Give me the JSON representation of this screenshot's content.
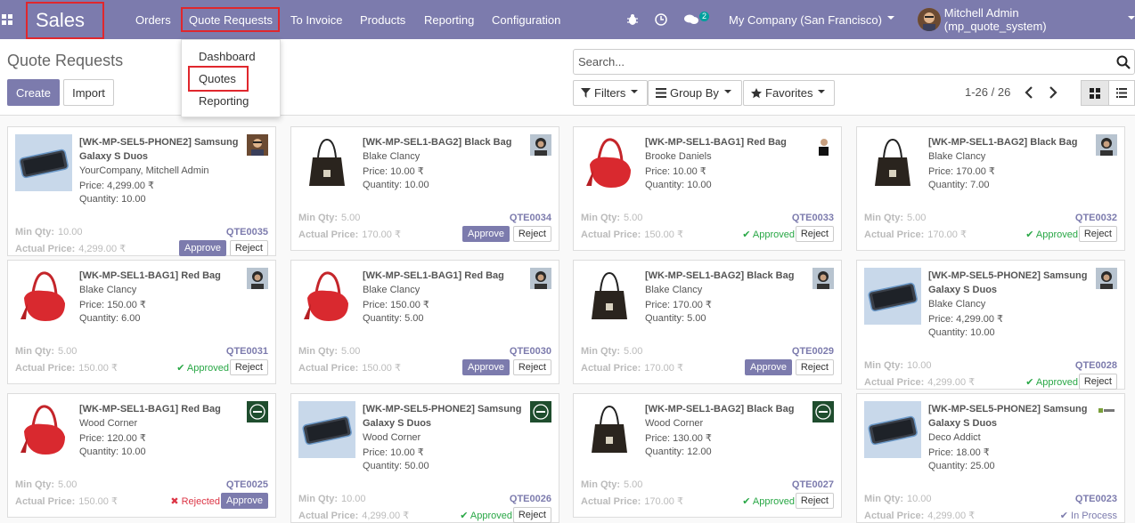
{
  "app": {
    "brand": "Sales"
  },
  "menu": {
    "orders": "Orders",
    "quote_requests": "Quote Requests",
    "to_invoice": "To Invoice",
    "products": "Products",
    "reporting": "Reporting",
    "configuration": "Configuration"
  },
  "systray": {
    "chat_count": "2",
    "company": "My Company (San Francisco)",
    "user": "Mitchell Admin (mp_quote_system)"
  },
  "dropdown": {
    "dashboard": "Dashboard",
    "quotes": "Quotes",
    "reporting": "Reporting"
  },
  "page": {
    "title": "Quote Requests",
    "create": "Create",
    "import": "Import"
  },
  "search": {
    "placeholder": "Search..."
  },
  "filters": {
    "filters": "Filters",
    "group_by": "Group By",
    "favorites": "Favorites"
  },
  "pager": {
    "range": "1-26 / 26"
  },
  "labels": {
    "min_qty": "Min Qty:",
    "actual_price": "Actual Price:",
    "approve": "Approve",
    "reject": "Reject",
    "approved": "Approved",
    "rejected": "Rejected",
    "in_process": "In Process"
  },
  "colors": {
    "primary": "#7c7bad",
    "approved": "#28a745",
    "rejected": "#dc3545",
    "highlight": "#e0272d"
  },
  "cards": [
    {
      "title": "[WK-MP-SEL5-PHONE2] Samsung Galaxy S Duos",
      "customer": "YourCompany, Mitchell Admin",
      "price": "Price: 4,299.00 ₹",
      "quantity": "Quantity: 10.00",
      "min_qty": "10.00",
      "actual_price": "4,299.00 ₹",
      "code": "QTE0035",
      "state": "pending",
      "image": "phone",
      "avatar": "admin"
    },
    {
      "title": "[WK-MP-SEL1-BAG2] Black Bag",
      "customer": "Blake Clancy",
      "price": "Price: 10.00 ₹",
      "quantity": "Quantity: 10.00",
      "min_qty": "5.00",
      "actual_price": "170.00 ₹",
      "code": "QTE0034",
      "state": "pending",
      "image": "black-bag",
      "avatar": "blake"
    },
    {
      "title": "[WK-MP-SEL1-BAG1] Red Bag",
      "customer": "Brooke Daniels",
      "price": "Price: 10.00 ₹",
      "quantity": "Quantity: 10.00",
      "min_qty": "5.00",
      "actual_price": "150.00 ₹",
      "code": "QTE0033",
      "state": "approved",
      "image": "red-bag",
      "avatar": "brooke"
    },
    {
      "title": "[WK-MP-SEL1-BAG2] Black Bag",
      "customer": "Blake Clancy",
      "price": "Price: 170.00 ₹",
      "quantity": "Quantity: 7.00",
      "min_qty": "5.00",
      "actual_price": "170.00 ₹",
      "code": "QTE0032",
      "state": "approved",
      "image": "black-bag",
      "avatar": "blake"
    },
    {
      "title": "[WK-MP-SEL1-BAG1] Red Bag",
      "customer": "Blake Clancy",
      "price": "Price: 150.00 ₹",
      "quantity": "Quantity: 6.00",
      "min_qty": "5.00",
      "actual_price": "150.00 ₹",
      "code": "QTE0031",
      "state": "approved",
      "image": "red-bag",
      "avatar": "blake"
    },
    {
      "title": "[WK-MP-SEL1-BAG1] Red Bag",
      "customer": "Blake Clancy",
      "price": "Price: 150.00 ₹",
      "quantity": "Quantity: 5.00",
      "min_qty": "5.00",
      "actual_price": "150.00 ₹",
      "code": "QTE0030",
      "state": "pending",
      "image": "red-bag",
      "avatar": "blake"
    },
    {
      "title": "[WK-MP-SEL1-BAG2] Black Bag",
      "customer": "Blake Clancy",
      "price": "Price: 170.00 ₹",
      "quantity": "Quantity: 5.00",
      "min_qty": "5.00",
      "actual_price": "170.00 ₹",
      "code": "QTE0029",
      "state": "pending",
      "image": "black-bag",
      "avatar": "blake"
    },
    {
      "title": "[WK-MP-SEL5-PHONE2] Samsung Galaxy S Duos",
      "customer": "Blake Clancy",
      "price": "Price: 4,299.00 ₹",
      "quantity": "Quantity: 10.00",
      "min_qty": "10.00",
      "actual_price": "4,299.00 ₹",
      "code": "QTE0028",
      "state": "approved",
      "image": "phone",
      "avatar": "blake"
    },
    {
      "title": "[WK-MP-SEL1-BAG1] Red Bag",
      "customer": "Wood Corner",
      "price": "Price: 120.00 ₹",
      "quantity": "Quantity: 10.00",
      "min_qty": "5.00",
      "actual_price": "150.00 ₹",
      "code": "QTE0025",
      "state": "rejected",
      "image": "red-bag",
      "avatar": "wood"
    },
    {
      "title": "[WK-MP-SEL5-PHONE2] Samsung Galaxy S Duos",
      "customer": "Wood Corner",
      "price": "Price: 10.00 ₹",
      "quantity": "Quantity: 50.00",
      "min_qty": "10.00",
      "actual_price": "4,299.00 ₹",
      "code": "QTE0026",
      "state": "approved",
      "image": "phone",
      "avatar": "wood"
    },
    {
      "title": "[WK-MP-SEL1-BAG2] Black Bag",
      "customer": "Wood Corner",
      "price": "Price: 130.00 ₹",
      "quantity": "Quantity: 12.00",
      "min_qty": "5.00",
      "actual_price": "170.00 ₹",
      "code": "QTE0027",
      "state": "approved",
      "image": "black-bag",
      "avatar": "wood"
    },
    {
      "title": "[WK-MP-SEL5-PHONE2] Samsung Galaxy S Duos",
      "customer": "Deco Addict",
      "price": "Price: 18.00 ₹",
      "quantity": "Quantity: 25.00",
      "min_qty": "10.00",
      "actual_price": "4,299.00 ₹",
      "code": "QTE0023",
      "state": "in_process",
      "image": "phone",
      "avatar": "deco"
    }
  ]
}
